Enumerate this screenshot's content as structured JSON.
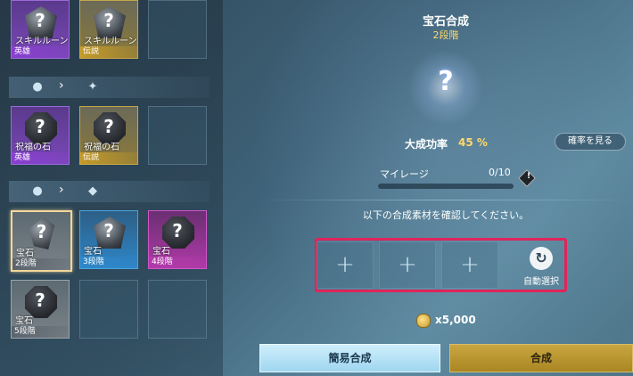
{
  "header": {
    "title": "宝石合成",
    "subtitle": "2段階"
  },
  "inventory": {
    "row1": [
      {
        "name": "スキルルーン",
        "grade": "英雄"
      },
      {
        "name": "スキルルーン",
        "grade": "伝説"
      }
    ],
    "row2": [
      {
        "name": "祝福の石",
        "grade": "英雄"
      },
      {
        "name": "祝福の石",
        "grade": "伝説"
      }
    ],
    "row3": [
      {
        "name": "宝石",
        "grade": "2段階"
      },
      {
        "name": "宝石",
        "grade": "3段階"
      },
      {
        "name": "宝石",
        "grade": "4段階"
      }
    ],
    "row4": [
      {
        "name": "宝石",
        "grade": "5段階"
      }
    ],
    "question_mark": "?",
    "arrow": "›"
  },
  "result": {
    "question_mark": "?",
    "rate_label": "大成功率",
    "rate_value": "45 %",
    "rate_button": "確率を見る"
  },
  "mileage": {
    "label": "マイレージ",
    "value": "0/10",
    "progress": 0.0,
    "info": "!"
  },
  "materials": {
    "instruction": "以下の合成素材を確認してください。",
    "plus": "+",
    "auto_label": "自動選択",
    "auto_icon": "↻"
  },
  "cost": {
    "amount": "x5,000"
  },
  "buttons": {
    "easy": "簡易合成",
    "combine": "合成"
  }
}
